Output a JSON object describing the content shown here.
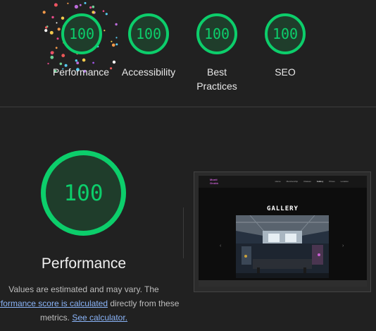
{
  "summary": {
    "categories": [
      {
        "score": "100",
        "label": "Performance"
      },
      {
        "score": "100",
        "label": "Accessibility"
      },
      {
        "score": "100",
        "label_line1": "Best",
        "label_line2": "Practices"
      },
      {
        "score": "100",
        "label": "SEO"
      }
    ]
  },
  "detail": {
    "score": "100",
    "title": "Performance",
    "desc_prefix": "Values are estimated and may vary. The",
    "desc_link1": "performance score is calculated",
    "desc_middle": " directly from these",
    "desc_line3_prefix": "metrics. ",
    "desc_link2": "See calculator."
  },
  "screenshot": {
    "logo_line1": "Monti",
    "logo_line2": "Grubb",
    "nav_links": [
      "Home",
      "Membership",
      "Classes",
      "Gallery",
      "Prices",
      "Location"
    ],
    "heading": "GALLERY",
    "prev_arrow": "‹",
    "next_arrow": "›"
  },
  "colors": {
    "pass_green": "#0cce6b",
    "gauge_fill": "#1f3d2b",
    "background": "#212121",
    "link": "#8ab4f8"
  }
}
